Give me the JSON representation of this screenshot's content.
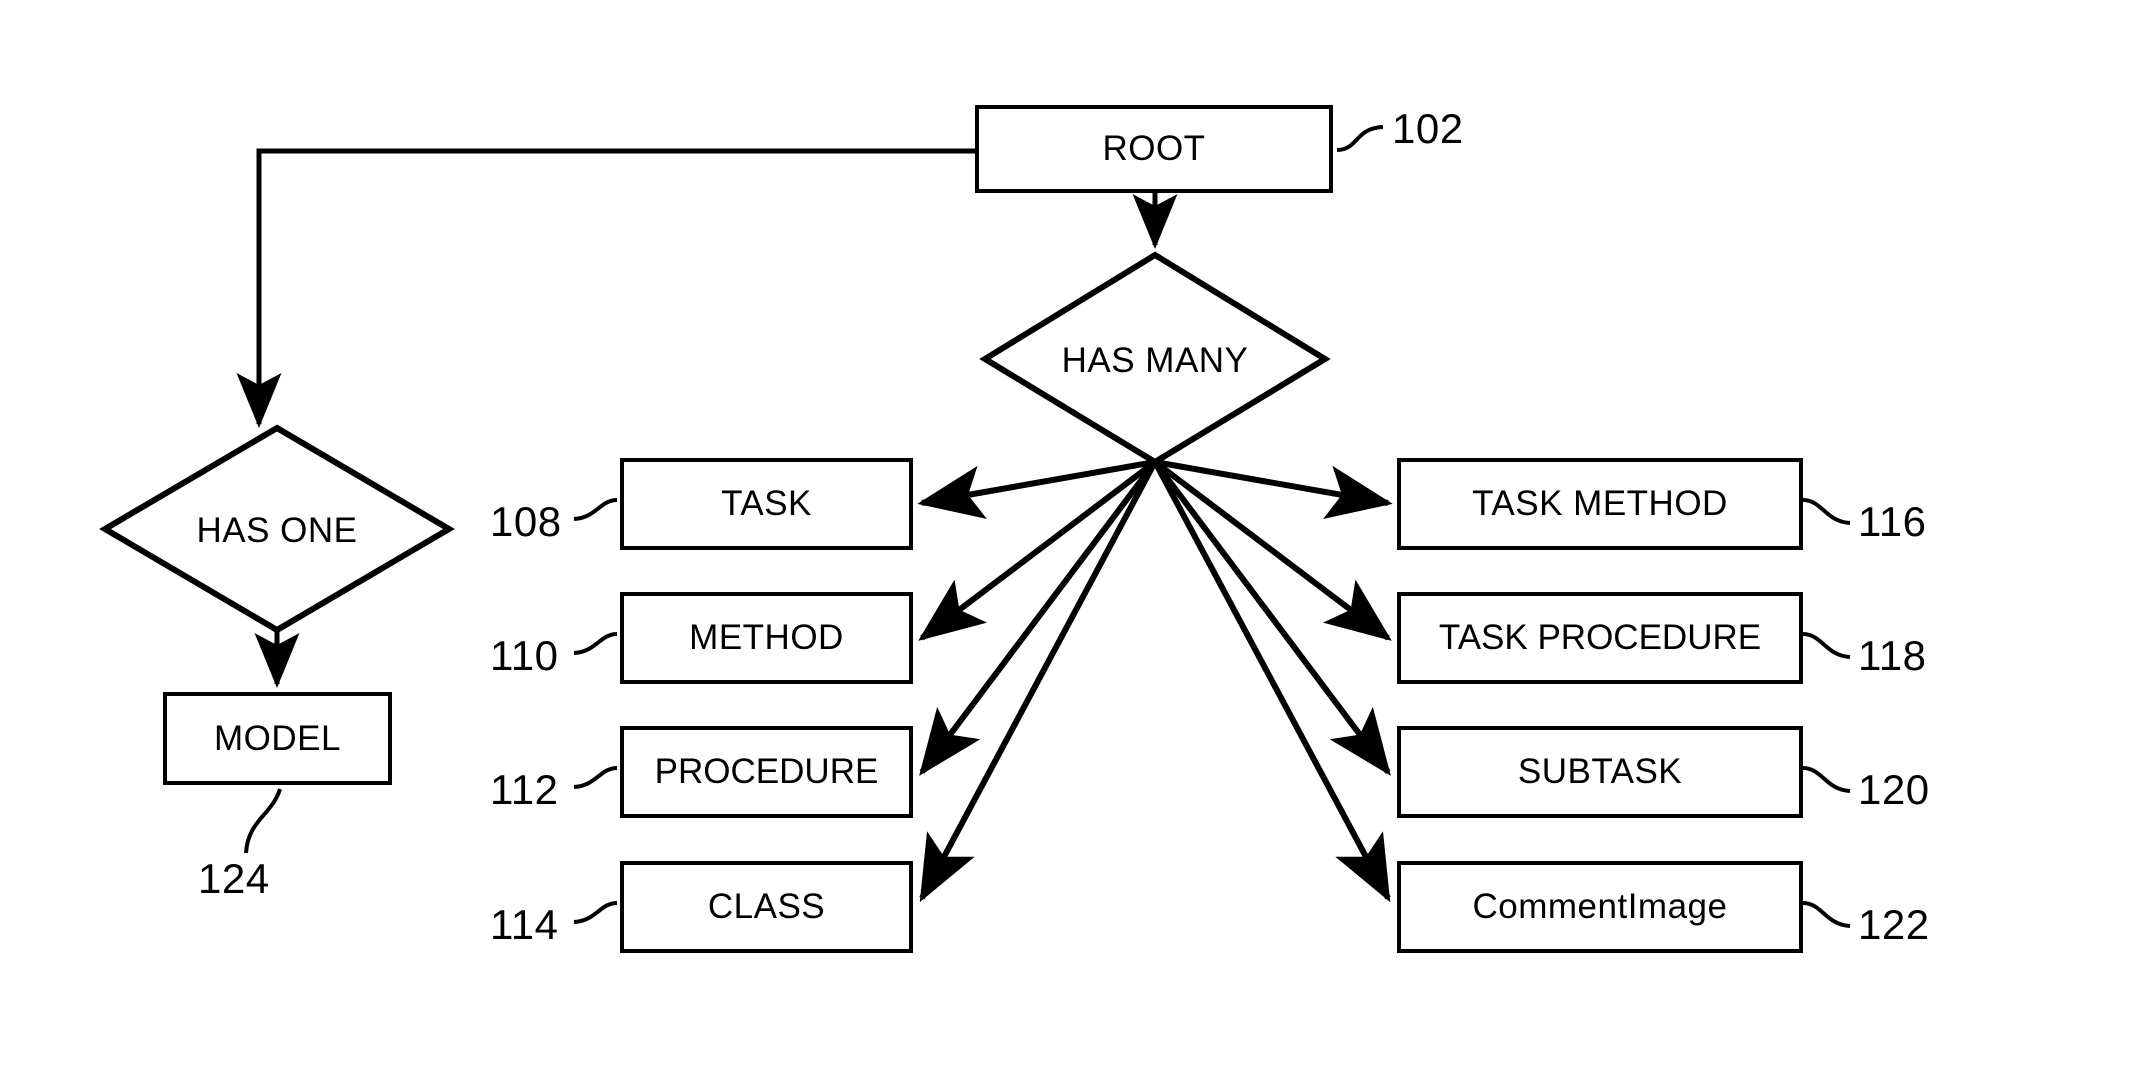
{
  "diagram": {
    "type": "patent-entity-relationship-hierarchy",
    "background_color": "#ffffff",
    "line_color": "#000000",
    "root": {
      "label": "ROOT",
      "ref": "102"
    },
    "relationships": {
      "has_one": {
        "label": "HAS ONE"
      },
      "has_many": {
        "label": "HAS MANY"
      }
    },
    "has_one_target": {
      "label": "MODEL",
      "ref": "124"
    },
    "has_many_targets_left": [
      {
        "label": "TASK",
        "ref": "108"
      },
      {
        "label": "METHOD",
        "ref": "110"
      },
      {
        "label": "PROCEDURE",
        "ref": "112"
      },
      {
        "label": "CLASS",
        "ref": "114"
      }
    ],
    "has_many_targets_right": [
      {
        "label": "TASK METHOD",
        "ref": "116"
      },
      {
        "label": "TASK PROCEDURE",
        "ref": "118"
      },
      {
        "label": "SUBTASK",
        "ref": "120"
      },
      {
        "label": "CommentImage",
        "ref": "122"
      }
    ]
  }
}
